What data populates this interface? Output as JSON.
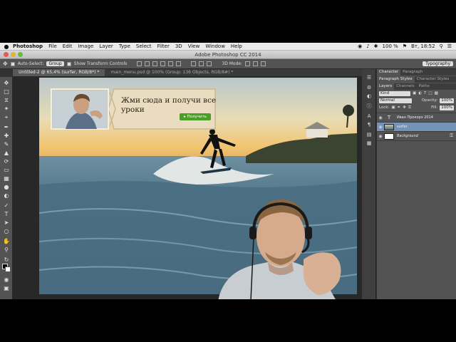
{
  "menubar": {
    "apple": "",
    "app": "Photoshop",
    "items": [
      "File",
      "Edit",
      "Image",
      "Layer",
      "Type",
      "Select",
      "Filter",
      "3D",
      "View",
      "Window",
      "Help"
    ],
    "battery": "100 %",
    "datetime": "Вт, 18:52"
  },
  "window": {
    "title": "Adobe Photoshop CC 2014"
  },
  "options": {
    "auto_select_label": "Auto-Select:",
    "auto_select_value": "Group",
    "transform_label": "Show Transform Controls",
    "mode_3d": "3D Mode:",
    "workspace": "Typography"
  },
  "tabs": [
    {
      "label": "Untitled-2 @ 65,4% (surfer, RGB/8*) *",
      "active": true
    },
    {
      "label": "main_menu.psd @ 100% (Group: 136 Objects, RGB/8#) *",
      "active": false
    }
  ],
  "banner": {
    "title": "Жми сюда и получи все уроки",
    "button": "▸ Получить"
  },
  "panels": {
    "top_tabs": [
      "Character",
      "Paragraph"
    ],
    "second_tabs": [
      "Paragraph Styles",
      "Character Styles"
    ],
    "layer_tabs": [
      "Layers",
      "Channels",
      "Paths"
    ],
    "kind": "Kind",
    "blend": "Normal",
    "opacity_label": "Opacity:",
    "opacity_value": "100%",
    "lock_label": "Lock:",
    "fill_label": "Fill:",
    "fill_value": "100%",
    "layers": [
      {
        "name": "Иван Прокорэ 2014",
        "type": "text",
        "selected": false
      },
      {
        "name": "surfer",
        "type": "image",
        "selected": true
      },
      {
        "name": "Background",
        "type": "background",
        "selected": false
      }
    ]
  },
  "colors": {
    "menubar": "#eaeaea",
    "toolbar": "#535353",
    "layer_selected": "#7592b8",
    "banner_button": "#4b9f26"
  }
}
